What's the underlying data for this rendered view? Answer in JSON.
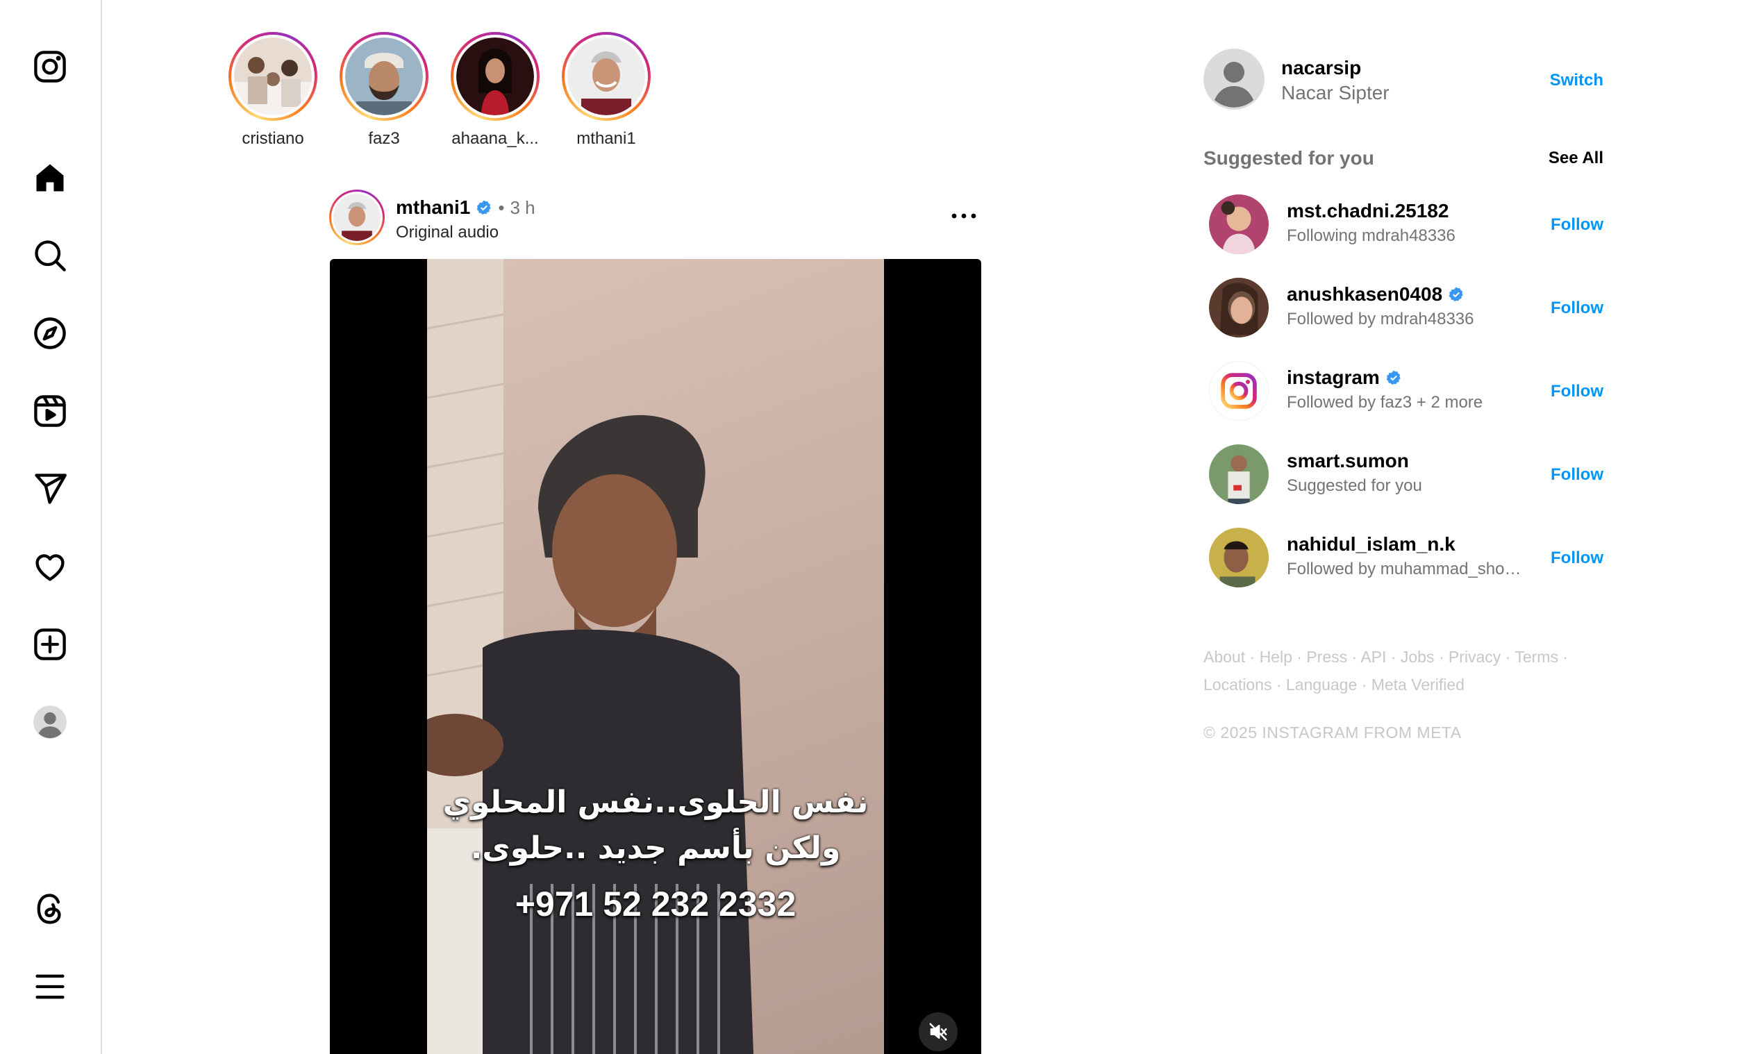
{
  "nav": {
    "items": [
      "instagram-logo",
      "home",
      "search",
      "explore",
      "reels",
      "messages",
      "notifications",
      "create",
      "profile",
      "threads",
      "more"
    ]
  },
  "stories": [
    {
      "username": "cristiano"
    },
    {
      "username": "faz3"
    },
    {
      "username": "ahaana_k..."
    },
    {
      "username": "mthani1"
    }
  ],
  "post": {
    "username": "mthani1",
    "separator": "•",
    "time": "3 h",
    "audio": "Original audio",
    "caption_line1": "نفس الحلوى..نفس المحلوي",
    "caption_line2": "ولكن بأسم جديد ..حلوى.",
    "caption_phone": "+971 52 232 2332"
  },
  "sidebar": {
    "me": {
      "username": "nacarsip",
      "name": "Nacar Sipter",
      "switch_label": "Switch"
    },
    "suggested_title": "Suggested for you",
    "see_all": "See All",
    "follow_label": "Follow",
    "suggestions": [
      {
        "username": "mst.chadni.25182",
        "verified": false,
        "subtitle": "Following mdrah48336"
      },
      {
        "username": "anushkasen0408",
        "verified": true,
        "subtitle": "Followed by mdrah48336"
      },
      {
        "username": "instagram",
        "verified": true,
        "subtitle": "Followed by faz3 + 2 more"
      },
      {
        "username": "smart.sumon",
        "verified": false,
        "subtitle": "Suggested for you"
      },
      {
        "username": "nahidul_islam_n.k",
        "verified": false,
        "subtitle": "Followed by muhammad_shohag_islam"
      }
    ],
    "footer_links": [
      "About",
      "Help",
      "Press",
      "API",
      "Jobs",
      "Privacy",
      "Terms",
      "Locations",
      "Language",
      "Meta Verified"
    ],
    "footer_sep": "·",
    "copyright": "© 2025 INSTAGRAM FROM META"
  },
  "colors": {
    "accent": "#0095f6",
    "muted": "#737373",
    "verified": "#3897f0"
  }
}
